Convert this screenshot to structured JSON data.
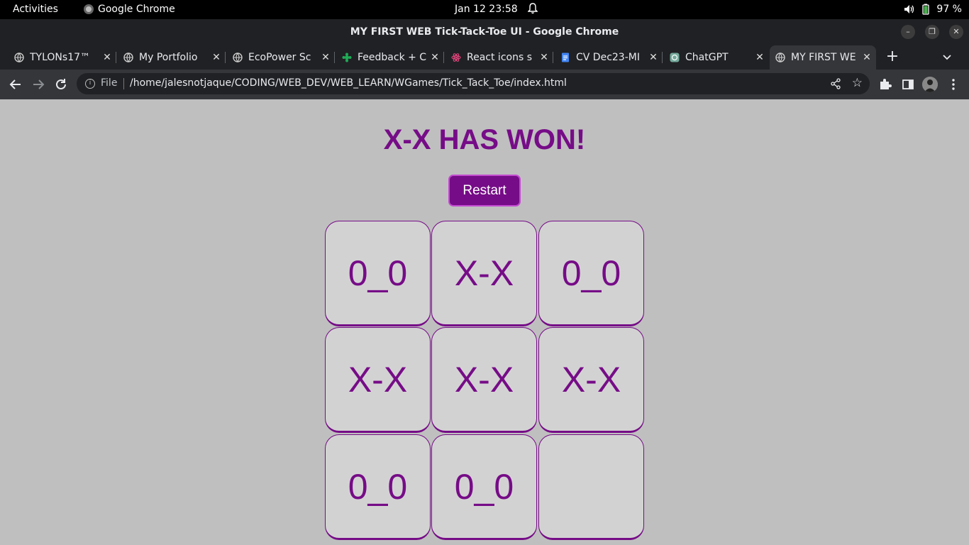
{
  "system": {
    "activities": "Activities",
    "app_name": "Google Chrome",
    "clock": "Jan 12  23:58",
    "battery": "97 %"
  },
  "window": {
    "title": "MY FIRST WEB Tick-Tack-Toe UI - Google Chrome"
  },
  "tabs": [
    {
      "label": "TYLONs17™"
    },
    {
      "label": "My Portfolio"
    },
    {
      "label": "EcoPower Sc"
    },
    {
      "label": "Feedback + C"
    },
    {
      "label": "React icons s"
    },
    {
      "label": "CV Dec23-MI"
    },
    {
      "label": "ChatGPT"
    },
    {
      "label": "MY FIRST WE"
    }
  ],
  "address_bar": {
    "scheme_label": "File",
    "url": "/home/jalesnotjaque/CODING/WEB_DEV/WEB_LEARN/WGames/Tick_Tack_Toe/index.html"
  },
  "game": {
    "status": "X-X HAS WON!",
    "restart_label": "Restart",
    "cells": [
      "0_0",
      "X-X",
      "0_0",
      "X-X",
      "X-X",
      "X-X",
      "0_0",
      "0_0",
      ""
    ]
  },
  "colors": {
    "accent": "#760c87",
    "page_bg": "#bfbfbf",
    "cell_bg": "#d3d2d3"
  }
}
